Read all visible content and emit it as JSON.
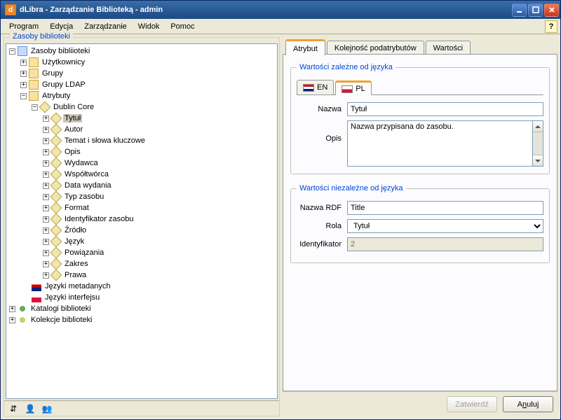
{
  "title": "dLibra - Zarządzanie Biblioteką - admin",
  "menu": {
    "program": "Program",
    "edycja": "Edycja",
    "zarzadzanie": "Zarządzanie",
    "widok": "Widok",
    "pomoc": "Pomoc"
  },
  "left": {
    "header": "Zasoby biblioteki",
    "root": "Zasoby bibliioteki",
    "uzytkownicy": "Użytkownicy",
    "grupy": "Grupy",
    "grupy_ldap": "Grupy LDAP",
    "atrybuty": "Atrybuty",
    "dublin_core": "Dublin Core",
    "dc": {
      "tytul": "Tytuł",
      "autor": "Autor",
      "temat": "Temat i słowa kluczowe",
      "opis": "Opis",
      "wydawca": "Wydawca",
      "wspoltworca": "Współtwórca",
      "data_wydania": "Data wydania",
      "typ_zasobu": "Typ zasobu",
      "format": "Format",
      "identyfikator": "Identyfikator zasobu",
      "zrodlo": "Źródło",
      "jezyk": "Język",
      "powiazania": "Powiązania",
      "zakres": "Zakres",
      "prawa": "Prawa"
    },
    "jezyki_meta": "Języki metadanych",
    "jezyki_ui": "Języki interfejsu",
    "katalogi": "Katalogi biblioteki",
    "kolekcje": "Kolekcje biblioteki"
  },
  "tabs": {
    "atrybut": "Atrybut",
    "kolejnosc": "Kolejność podatrybutów",
    "wartosci": "Wartości"
  },
  "lang_section": {
    "legend": "Wartości zależne od języka",
    "en": "EN",
    "pl": "PL",
    "nazwa_label": "Nazwa",
    "nazwa_value": "Tytuł",
    "opis_label": "Opis",
    "opis_value": "Nazwa przypisana do zasobu."
  },
  "indep_section": {
    "legend": "Wartości niezależne od języka",
    "rdf_label": "Nazwa RDF",
    "rdf_value": "Title",
    "rola_label": "Rola",
    "rola_value": "Tytuł",
    "id_label": "Identyfikator",
    "id_value": "2"
  },
  "buttons": {
    "zatwierdz": "Zatwierdź",
    "anuluj_pre": "A",
    "anuluj_u": "n",
    "anuluj_post": "uluj"
  }
}
